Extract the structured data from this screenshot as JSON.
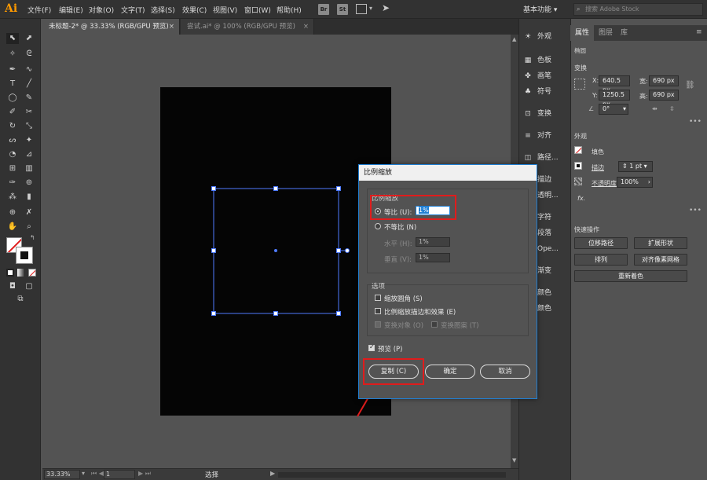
{
  "app": {
    "logo": "Ai"
  },
  "menu": [
    "文件(F)",
    "编辑(E)",
    "对象(O)",
    "文字(T)",
    "选择(S)",
    "效果(C)",
    "视图(V)",
    "窗口(W)",
    "帮助(H)"
  ],
  "toolbar_buttons": {
    "br": "Br",
    "st": "St"
  },
  "workspace": "基本功能",
  "search_placeholder": "搜索 Adobe Stock",
  "tabs": [
    {
      "label": "未标题-2* @ 33.33% (RGB/GPU 预览)",
      "close": "×"
    },
    {
      "label": "尝试.ai* @ 100% (RGB/GPU 预览)",
      "close": "×"
    }
  ],
  "status": {
    "zoom": "33.33%",
    "artboard": "1",
    "mode": "选择"
  },
  "dock": [
    {
      "icon": "☀",
      "label": "外观"
    },
    {
      "icon": "▦",
      "label": "色板"
    },
    {
      "icon": "✤",
      "label": "画笔"
    },
    {
      "icon": "♣",
      "label": "符号"
    },
    {
      "icon": "⊡",
      "label": "变换"
    },
    {
      "icon": "≡",
      "label": "对齐"
    },
    {
      "icon": "◫",
      "label": "路径..."
    },
    {
      "icon": "",
      "label": "描边"
    },
    {
      "icon": "",
      "label": "透明..."
    },
    {
      "icon": "",
      "label": "字符"
    },
    {
      "icon": "",
      "label": "段落"
    },
    {
      "icon": "",
      "label": "Ope..."
    },
    {
      "icon": "",
      "label": "渐变"
    },
    {
      "icon": "",
      "label": "颜色"
    },
    {
      "icon": "",
      "label": "颜色"
    }
  ],
  "panel": {
    "tabs": [
      "属性",
      "图层",
      "库"
    ],
    "object_type": "椭圆",
    "transform": {
      "title": "变换",
      "x_label": "X:",
      "x": "640.5 px",
      "y_label": "Y:",
      "y": "1250.5 px",
      "w_label": "宽:",
      "w": "690 px",
      "h_label": "高:",
      "h": "690 px",
      "angle": "0°"
    },
    "appearance": {
      "title": "外观",
      "fill": "填色",
      "stroke": "描边",
      "stroke_value": "1 pt",
      "opacity_label": "不透明度",
      "opacity": "100%",
      "fx": "fx."
    },
    "quick_actions": {
      "title": "快速操作",
      "offset_path": "位移路径",
      "expand_shape": "扩展形状",
      "arrange": "排列",
      "align_pixel": "对齐像素网格",
      "recolor": "重新着色"
    }
  },
  "dialog": {
    "title": "比例缩放",
    "section_scale": "比例缩放",
    "uniform_label": "等比 (U):",
    "uniform_value": "1%",
    "nonuniform_label": "不等比 (N)",
    "horizontal_label": "水平 (H):",
    "horizontal_value": "1%",
    "vertical_label": "垂直 (V):",
    "vertical_value": "1%",
    "section_options": "选项",
    "scale_corners": "缩放圆角 (S)",
    "scale_strokes": "比例缩放描边和效果 (E)",
    "transform_objects": "变换对象 (O)",
    "transform_patterns": "变换图案 (T)",
    "preview": "预览 (P)",
    "copy_button": "复制 (C)",
    "ok_button": "确定",
    "cancel_button": "取消"
  }
}
